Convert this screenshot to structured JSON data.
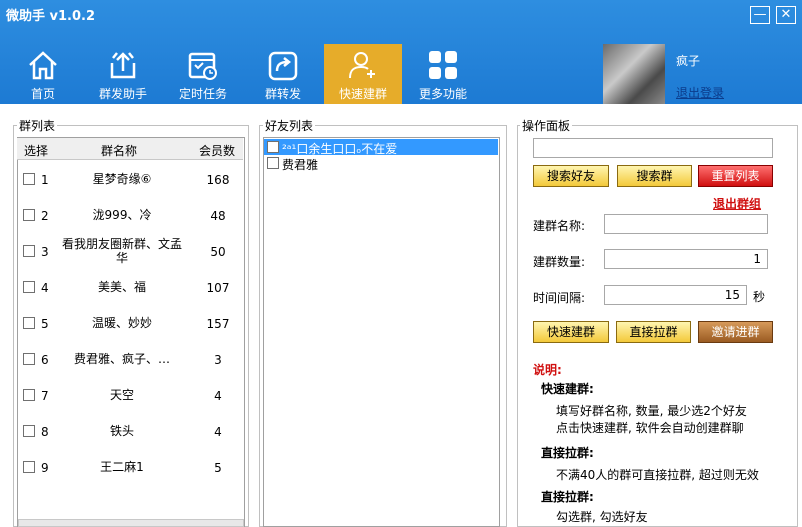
{
  "app": {
    "title": "微助手 v1.0.2",
    "minimize": "—",
    "close": "✕"
  },
  "nav": [
    {
      "label": "首页"
    },
    {
      "label": "群发助手"
    },
    {
      "label": "定时任务"
    },
    {
      "label": "群转发"
    },
    {
      "label": "快速建群"
    },
    {
      "label": "更多功能"
    }
  ],
  "user": {
    "name": "疯子",
    "logout": "退出登录"
  },
  "group_list": {
    "title": "群列表",
    "headers": [
      "选择",
      "群名称",
      "会员数"
    ],
    "rows": [
      {
        "num": "1",
        "name": "星梦奇缘⑥",
        "count": "168"
      },
      {
        "num": "2",
        "name": "泷999、冷",
        "count": "48"
      },
      {
        "num": "3",
        "name": "看我朋友圈新群、文孟华",
        "count": "50"
      },
      {
        "num": "4",
        "name": "美美、福",
        "count": "107"
      },
      {
        "num": "5",
        "name": "温暖、妙妙",
        "count": "157"
      },
      {
        "num": "6",
        "name": "费君雅、疯子、…",
        "count": "3"
      },
      {
        "num": "7",
        "name": "天空",
        "count": "4"
      },
      {
        "num": "8",
        "name": "铁头",
        "count": "4"
      },
      {
        "num": "9",
        "name": "王二麻1",
        "count": "5"
      }
    ]
  },
  "friend_list": {
    "title": "好友列表",
    "rows": [
      {
        "name": "²ᵃ¹口余生口口ₒ不在爱",
        "selected": true
      },
      {
        "name": "费君雅",
        "selected": false
      }
    ]
  },
  "ops": {
    "title": "操作面板",
    "search_value": "",
    "search_friend": "搜索好友",
    "search_group": "搜索群",
    "reset_list": "重置列表",
    "exit_group": "退出群组",
    "name_label": "建群名称:",
    "name_value": "",
    "count_label": "建群数量:",
    "count_value": "1",
    "interval_label": "时间间隔:",
    "interval_value": "15",
    "interval_unit": "秒",
    "quick_build": "快速建群",
    "direct_pull": "直接拉群",
    "invite": "邀请进群"
  },
  "notes": {
    "title": "说明:",
    "h1": "快速建群:",
    "l1": "填写好群名称, 数量, 最少选2个好友",
    "l2": "点击快速建群, 软件会自动创建群聊",
    "h2": "直接拉群:",
    "l3": "不满40人的群可直接拉群, 超过则无效",
    "h3": "直接拉群:",
    "l4": "勾选群, 勾选好友"
  }
}
